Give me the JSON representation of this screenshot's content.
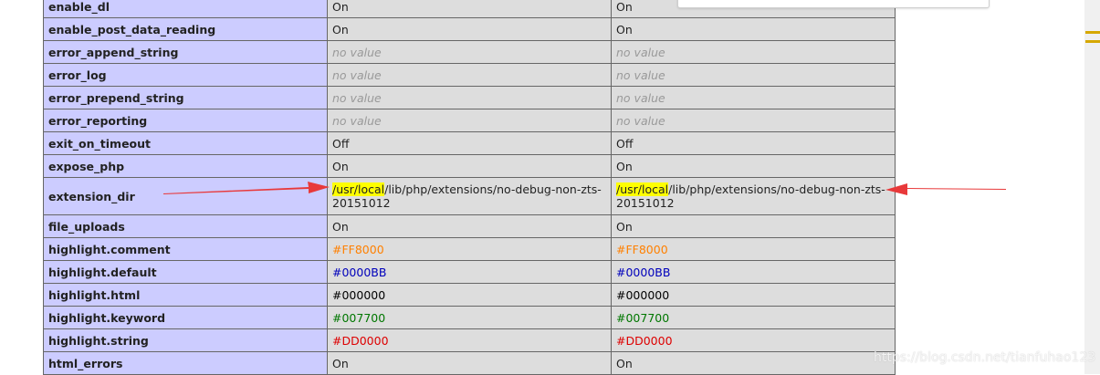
{
  "rows": [
    {
      "directive": "enable_dl",
      "local": "On",
      "master": "On"
    },
    {
      "directive": "enable_post_data_reading",
      "local": "On",
      "master": "On"
    },
    {
      "directive": "error_append_string",
      "local": "no value",
      "master": "no value"
    },
    {
      "directive": "error_log",
      "local": "no value",
      "master": "no value"
    },
    {
      "directive": "error_prepend_string",
      "local": "no value",
      "master": "no value"
    },
    {
      "directive": "error_reporting",
      "local": "no value",
      "master": "no value"
    },
    {
      "directive": "exit_on_timeout",
      "local": "Off",
      "master": "Off"
    },
    {
      "directive": "expose_php",
      "local": "On",
      "master": "On"
    },
    {
      "directive": "extension_dir",
      "local_highlight": "/usr/local",
      "local_rest": "/lib/php/extensions/no-debug-non-zts-20151012",
      "master_highlight": "/usr/local",
      "master_rest": "/lib/php/extensions/no-debug-non-zts-20151012"
    },
    {
      "directive": "file_uploads",
      "local": "On",
      "master": "On"
    },
    {
      "directive": "highlight.comment",
      "local": "#FF8000",
      "master": "#FF8000"
    },
    {
      "directive": "highlight.default",
      "local": "#0000BB",
      "master": "#0000BB"
    },
    {
      "directive": "highlight.html",
      "local": "#000000",
      "master": "#000000"
    },
    {
      "directive": "highlight.keyword",
      "local": "#007700",
      "master": "#007700"
    },
    {
      "directive": "highlight.string",
      "local": "#DD0000",
      "master": "#DD0000"
    },
    {
      "directive": "html_errors",
      "local": "On",
      "master": "On"
    }
  ],
  "colors": {
    "directive_bg": "#ccccff",
    "value_bg": "#dddddd",
    "highlight": "#ffff00",
    "arrow": "#e8393a"
  },
  "watermark": "https://blog.csdn.net/tianfuhao123"
}
